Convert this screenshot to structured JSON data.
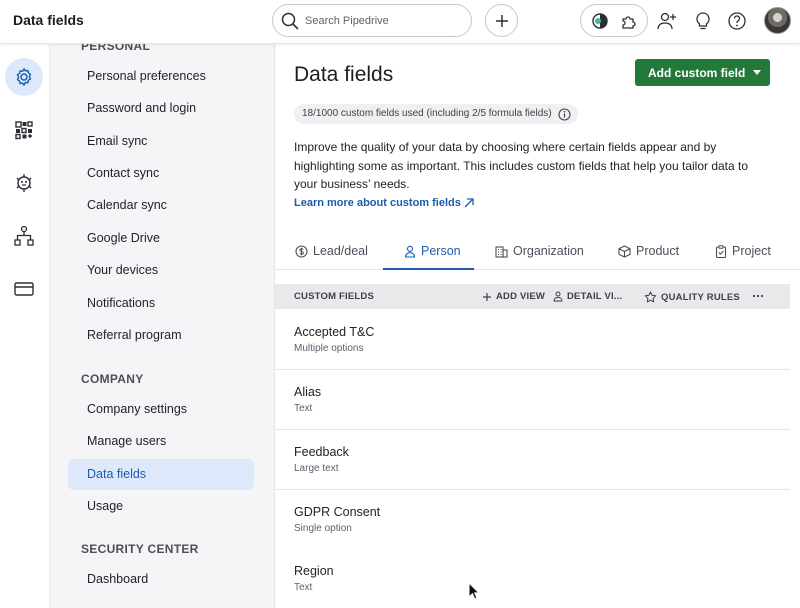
{
  "app": {
    "title": "Data fields"
  },
  "search": {
    "placeholder": "Search Pipedrive"
  },
  "sidebar": {
    "sections": [
      {
        "label": "PERSONAL",
        "items": [
          {
            "label": "Personal preferences"
          },
          {
            "label": "Password and login"
          },
          {
            "label": "Email sync"
          },
          {
            "label": "Contact sync"
          },
          {
            "label": "Calendar sync"
          },
          {
            "label": "Google Drive"
          },
          {
            "label": "Your devices"
          },
          {
            "label": "Notifications"
          },
          {
            "label": "Referral program"
          }
        ]
      },
      {
        "label": "COMPANY",
        "items": [
          {
            "label": "Company settings"
          },
          {
            "label": "Manage users"
          },
          {
            "label": "Data fields",
            "active": true
          },
          {
            "label": "Usage"
          }
        ]
      },
      {
        "label": "SECURITY CENTER",
        "items": [
          {
            "label": "Dashboard"
          }
        ]
      }
    ]
  },
  "main": {
    "title": "Data fields",
    "add_button": "Add custom field",
    "usage_badge": "18/1000 custom fields used (including 2/5 formula fields)",
    "description": "Improve the quality of your data by choosing where certain fields appear and by highlighting some as important. This includes custom fields that help you tailor data to your business’ needs.",
    "learn_link": "Learn more about custom fields",
    "tabs": [
      {
        "label": "Lead/deal",
        "icon": "dollar-icon"
      },
      {
        "label": "Person",
        "icon": "person-icon",
        "active": true
      },
      {
        "label": "Organization",
        "icon": "building-icon"
      },
      {
        "label": "Product",
        "icon": "box-icon"
      },
      {
        "label": "Project",
        "icon": "clipboard-icon"
      }
    ],
    "fields_header": {
      "title": "CUSTOM FIELDS",
      "add_view": "ADD VIEW",
      "detail_view": "DETAIL VI...",
      "quality_rules": "QUALITY RULES"
    },
    "fields": [
      {
        "name": "Accepted T&C",
        "type": "Multiple options"
      },
      {
        "name": "Alias",
        "type": "Text"
      },
      {
        "name": "Feedback",
        "type": "Large text"
      },
      {
        "name": "GDPR Consent",
        "type": "Single option"
      },
      {
        "name": "Region",
        "type": "Text"
      }
    ]
  },
  "colors": {
    "accent": "#1b5cad",
    "primary_button": "#23783a",
    "active_bg": "#dde9fb"
  }
}
